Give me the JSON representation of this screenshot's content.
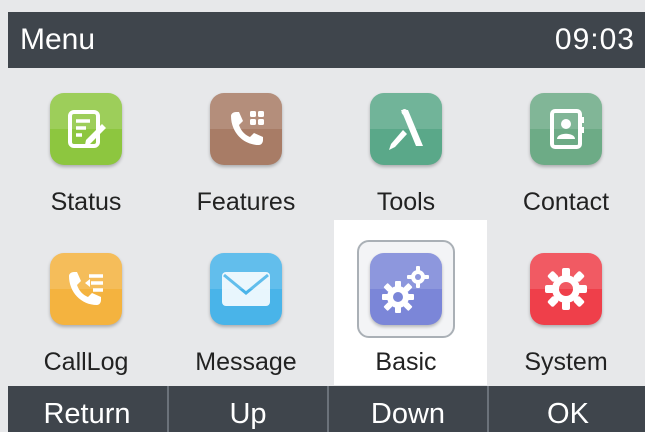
{
  "header": {
    "title": "Menu",
    "time": "09:03"
  },
  "menu": {
    "items": [
      {
        "label": "Status",
        "icon": "status-icon",
        "color": "#8dc63f"
      },
      {
        "label": "Features",
        "icon": "features-icon",
        "color": "#a87c66"
      },
      {
        "label": "Tools",
        "icon": "tools-icon",
        "color": "#5aa889"
      },
      {
        "label": "Contact",
        "icon": "contact-icon",
        "color": "#6dab86"
      },
      {
        "label": "CallLog",
        "icon": "calllog-icon",
        "color": "#f4b33f"
      },
      {
        "label": "Message",
        "icon": "message-icon",
        "color": "#49b4e9"
      },
      {
        "label": "Basic",
        "icon": "basic-gears-icon",
        "color": "#7b86d8"
      },
      {
        "label": "System",
        "icon": "system-gear-icon",
        "color": "#ef3f4a"
      }
    ],
    "selected": "Basic"
  },
  "softkeys": [
    "Return",
    "Up",
    "Down",
    "OK"
  ]
}
